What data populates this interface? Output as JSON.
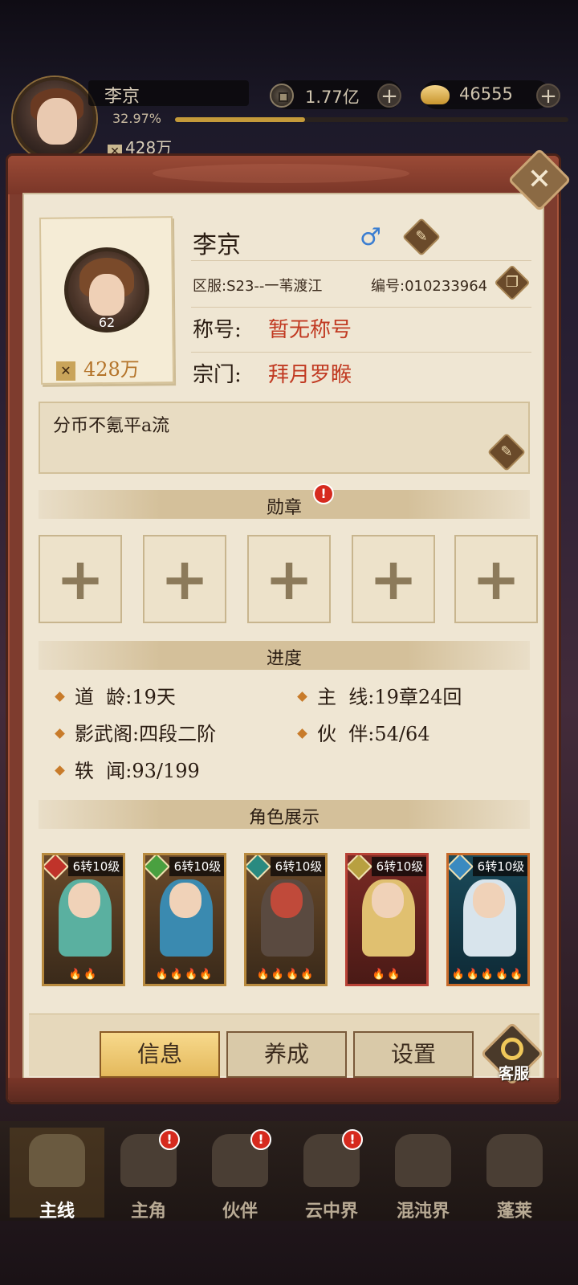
{
  "hud": {
    "name": "李京",
    "exp_text": "32.97%",
    "exp_fraction": 0.3297,
    "power": "428万",
    "coins": "1.77亿",
    "ingots": "46555",
    "plus": "+"
  },
  "profile": {
    "name": "李京",
    "gender_symbol": "♂",
    "server": "区服:S23--一苇渡江",
    "id": "编号:010233964",
    "title_label": "称号:",
    "title_value": "暂无称号",
    "sect_label": "宗门:",
    "sect_value": "拜月罗睺",
    "level": "62",
    "power": "428万",
    "signature": "分币不氪平a流"
  },
  "sections": {
    "medals": "勋章",
    "progress": "进度",
    "characters": "角色展示"
  },
  "medal_slots": [
    "+",
    "+",
    "+",
    "+",
    "+"
  ],
  "progress": {
    "dao_age": "道  龄:19天",
    "main_line": "主  线:19章24回",
    "shadow_pavilion": "影武阁:四段二阶",
    "partners": "伙  伴:54/64",
    "news": "轶  闻:93/199"
  },
  "heroes": [
    {
      "level": "6转10级",
      "element_color": "#c0332a",
      "flames": "🔥🔥"
    },
    {
      "level": "6转10级",
      "element_color": "#4aa040",
      "flames": "🔥🔥🔥🔥"
    },
    {
      "level": "6转10级",
      "element_color": "#2a8a80",
      "flames": "🔥🔥🔥🔥"
    },
    {
      "level": "6转10级",
      "element_color": "#b8a040",
      "flames": "🔥🔥"
    },
    {
      "level": "6转10级",
      "element_color": "#3a8ac0",
      "flames": "🔥🔥🔥🔥🔥"
    }
  ],
  "tabs": {
    "info": "信息",
    "develop": "养成",
    "settings": "设置",
    "customer_service": "客服"
  },
  "nav": [
    {
      "label": "主线",
      "active": true,
      "alert": false
    },
    {
      "label": "主角",
      "active": false,
      "alert": true
    },
    {
      "label": "伙伴",
      "active": false,
      "alert": true
    },
    {
      "label": "云中界",
      "active": false,
      "alert": true
    },
    {
      "label": "混沌界",
      "active": false,
      "alert": false
    },
    {
      "label": "蓬莱",
      "active": false,
      "alert": false
    }
  ],
  "alert_symbol": "!",
  "close_symbol": "✕",
  "power_icon": "✕",
  "edit_icon": "✎",
  "copy_icon": "❐"
}
